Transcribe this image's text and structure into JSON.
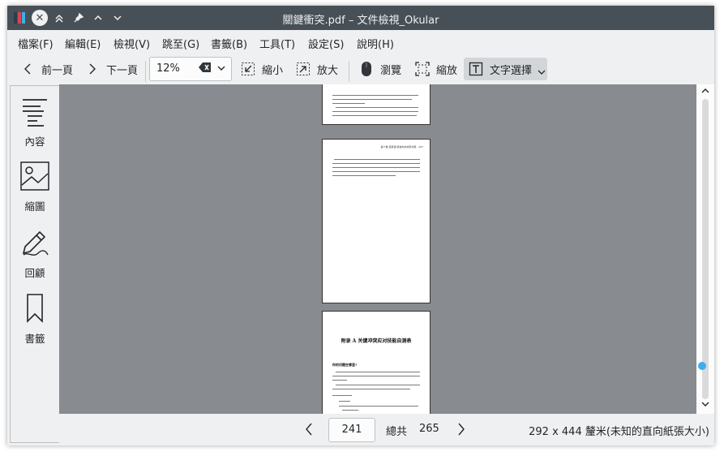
{
  "window": {
    "title": "關鍵衝突.pdf – 文件檢視_Okular"
  },
  "menu": {
    "items": [
      "檔案(F)",
      "編輯(E)",
      "檢視(V)",
      "跳至(G)",
      "書籤(B)",
      "工具(T)",
      "設定(S)",
      "說明(H)"
    ]
  },
  "toolbar": {
    "prev_label": "前一頁",
    "next_label": "下一頁",
    "zoom_value": "12%",
    "zoom_out_label": "縮小",
    "zoom_in_label": "放大",
    "browse_label": "瀏覽",
    "zoom_tool_label": "縮放",
    "text_select_label": "文字選擇"
  },
  "sidebar": {
    "items": [
      {
        "label": "內容",
        "icon": "contents-icon"
      },
      {
        "label": "縮圖",
        "icon": "thumbnails-icon"
      },
      {
        "label": "回顧",
        "icon": "review-icon"
      },
      {
        "label": "書籤",
        "icon": "bookmarks-icon"
      }
    ]
  },
  "document": {
    "page_header": "第十章 结束语 前进中的关键冲突 · 207",
    "appendix_title": "附录 A   关键冲突应对技能自测表",
    "appendix_subtitle": "你的问题在哪里?"
  },
  "status": {
    "current_page": "241",
    "total_label": "總共",
    "total_pages": "265",
    "paper_size": "292 x 444 釐米(未知的直向紙張大小)"
  },
  "colors": {
    "titlebar": "#475057",
    "accent": "#3daee9",
    "document_background": "#888b8f"
  }
}
